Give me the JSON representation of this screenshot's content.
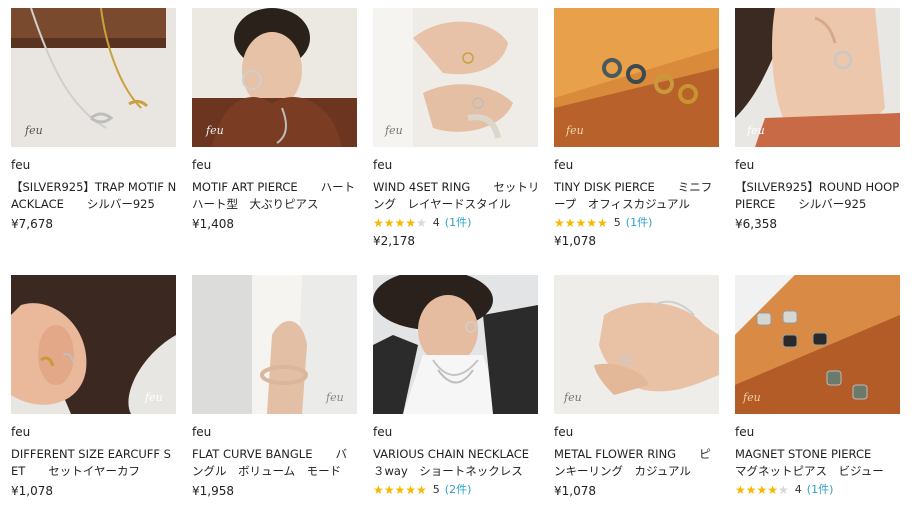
{
  "products": [
    {
      "shop": "feu",
      "title": "【SILVER925】TRAP MOTIF NACKLACE　　シルバー925",
      "price": "¥7,678",
      "image": "necklace-on-wood-photo",
      "watermark": "feu"
    },
    {
      "shop": "feu",
      "title": "MOTIF ART PIERCE　　ハート　ハート型　大ぶりピアス",
      "price": "¥1,408",
      "image": "model-hoop-earring-photo",
      "watermark": "feu"
    },
    {
      "shop": "feu",
      "title": "WIND 4SET RING　　セットリング　レイヤードスタイル",
      "rating_value": "4",
      "rating_count": "(1件)",
      "stars": 4,
      "price": "¥2,178",
      "image": "hands-rings-photo",
      "watermark": "feu"
    },
    {
      "shop": "feu",
      "title": "TINY DISK PIERCE　　ミニフープ　オフィスカジュアル",
      "rating_value": "5",
      "rating_count": "(1件)",
      "stars": 5,
      "price": "¥1,078",
      "image": "tiny-hoops-on-wood-photo",
      "watermark": "feu"
    },
    {
      "shop": "feu",
      "title": "【SILVER925】ROUND HOOP PIERCE　　シルバー925",
      "price": "¥6,358",
      "image": "ear-hoop-photo",
      "watermark": "feu"
    },
    {
      "shop": "feu",
      "title": "DIFFERENT SIZE EARCUFF SET　　セットイヤーカフ　",
      "price": "¥1,078",
      "image": "ear-cuff-photo",
      "watermark": "feu"
    },
    {
      "shop": "feu",
      "title": "FLAT CURVE BANGLE　　バングル　ボリューム　モード",
      "price": "¥1,958",
      "image": "bangle-wrist-photo",
      "watermark": "feu"
    },
    {
      "shop": "feu",
      "title": "VARIOUS CHAIN NECKLACE　　３way　ショートネックレス",
      "rating_value": "5",
      "rating_count": "(2件)",
      "stars": 5,
      "price": "",
      "image": "model-chain-necklace-photo",
      "watermark": ""
    },
    {
      "shop": "feu",
      "title": "METAL FLOWER RING　　ピンキーリング　カジュアル",
      "price": "¥1,078",
      "image": "hand-flower-ring-photo",
      "watermark": "feu"
    },
    {
      "shop": "feu",
      "title": "MAGNET STONE PIERCE　　マグネットピアス　ビジュー",
      "rating_value": "4",
      "rating_count": "(1件)",
      "stars": 4,
      "price": "",
      "image": "stone-earrings-on-wood-photo",
      "watermark": "feu"
    }
  ]
}
